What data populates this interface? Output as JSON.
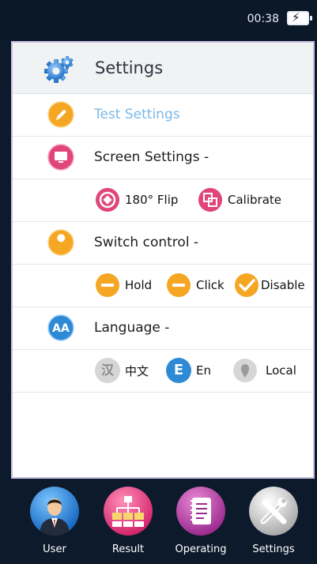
{
  "status": {
    "time": "00:38",
    "battery": "charging"
  },
  "header": {
    "title": "Settings",
    "icon": "gear-icon"
  },
  "rows": {
    "test": {
      "label": "Test Settings",
      "icon": "pencil-icon",
      "color": "#f5a623"
    },
    "screen": {
      "label": "Screen Settings -",
      "icon": "monitor-icon",
      "color": "#e0457b",
      "options": [
        {
          "label": "180° Flip",
          "icon": "flip-icon"
        },
        {
          "label": "Calibrate",
          "icon": "calibrate-icon"
        }
      ]
    },
    "switch": {
      "label": "Switch control -",
      "icon": "wrench-icon",
      "color": "#f5a623",
      "options": [
        {
          "label": "Hold",
          "icon": "minus-icon"
        },
        {
          "label": "Click",
          "icon": "minus-icon"
        },
        {
          "label": "Disable",
          "icon": "check-icon"
        }
      ]
    },
    "language": {
      "label": "Language -",
      "icon": "language-icon",
      "color": "#2f8ad6",
      "options": [
        {
          "glyph": "汉",
          "label": "中文",
          "icon": "chinese-icon"
        },
        {
          "glyph": "E",
          "label": "En",
          "icon": "english-icon"
        },
        {
          "label": "Local",
          "icon": "location-icon"
        }
      ]
    }
  },
  "nav": [
    {
      "label": "User",
      "icon": "user-icon"
    },
    {
      "label": "Result",
      "icon": "result-icon"
    },
    {
      "label": "Operating",
      "icon": "operating-icon"
    },
    {
      "label": "Settings",
      "icon": "tools-icon"
    }
  ]
}
